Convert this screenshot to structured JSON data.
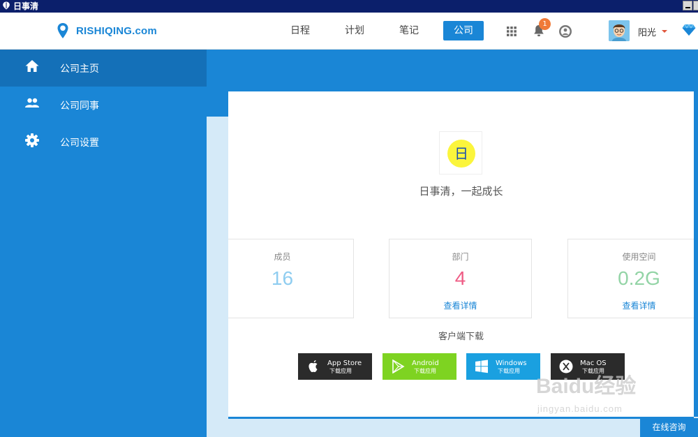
{
  "window": {
    "title": "日事清"
  },
  "header": {
    "logo_text": "RISHIQING.com",
    "nav": [
      "日程",
      "计划",
      "笔记",
      "公司"
    ],
    "active_nav": "公司",
    "notification_count": "1",
    "user_name": "阳光"
  },
  "sidebar": {
    "items": [
      {
        "label": "公司主页",
        "icon": "home-icon"
      },
      {
        "label": "公司同事",
        "icon": "people-icon"
      },
      {
        "label": "公司设置",
        "icon": "gear-icon"
      }
    ]
  },
  "company": {
    "logo_char": "日",
    "slogan": "日事清，一起成长"
  },
  "stats": [
    {
      "label": "成员",
      "value": "16",
      "color": "#8fcdf0"
    },
    {
      "label": "部门",
      "value": "4",
      "color": "#ef5c85",
      "link": "查看详情"
    },
    {
      "label": "使用空间",
      "value": "0.2G",
      "color": "#93d4a6",
      "link": "查看详情"
    }
  ],
  "downloads": {
    "title": "客户端下载",
    "items": [
      {
        "name": "App Store",
        "sub": "下载应用",
        "color": "#2b2b2b"
      },
      {
        "name": "Android",
        "sub": "下载应用",
        "color": "#7ed321"
      },
      {
        "name": "Windows",
        "sub": "下载应用",
        "color": "#1aa0e0"
      },
      {
        "name": "Mac OS",
        "sub": "下载应用",
        "color": "#2b2b2b"
      }
    ]
  },
  "watermark": {
    "big": "Baidu经验",
    "small": "jingyan.baidu.com"
  },
  "consult_label": "在线咨询",
  "colors": {
    "primary": "#1a86d6",
    "sidebar_active": "#1470b8",
    "titlebar": "#0b1f6b"
  }
}
